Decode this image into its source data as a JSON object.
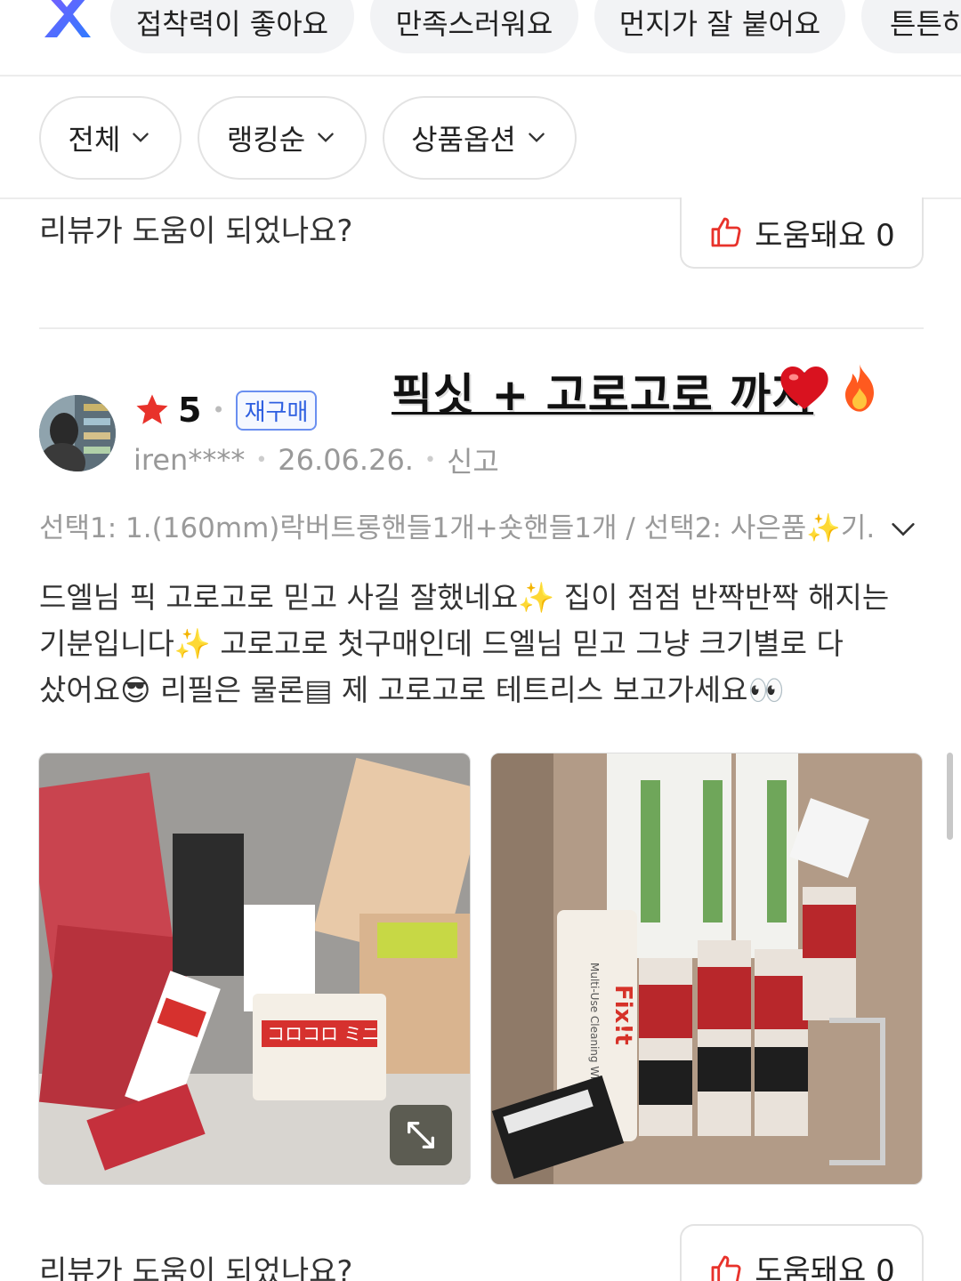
{
  "keyword_chips": [
    "접착력이 좋아요",
    "만족스러워요",
    "먼지가 잘 붙어요",
    "튼튼하"
  ],
  "filters": [
    "전체",
    "랭킹순",
    "상품옵션"
  ],
  "help_prompt": "리뷰가 도움이 되었나요?",
  "helpful_label": "도움돼요 0",
  "review": {
    "rating": "5",
    "rebuy_badge": "재구매",
    "user": "iren****",
    "date": "26.06.26.",
    "report": "신고",
    "title_text": "픽싯 + 고로고로 까지",
    "option": "선택1: 1.(160mm)락버트롱핸들1개+숏핸들1개 / 선택2: 사은품✨기...",
    "body_lines": [
      "드엘님 픽 고로고로 믿고 사길 잘했네요✨ 집이 점점 반짝반짝 해지는",
      "기분입니다✨ 고로고로 첫구매인데 드엘님 믿고 그냥 크기별로 다",
      "샀어요😎 리필은 물론▤ 제 고로고로 테트리스 보고가세요👀"
    ],
    "photo_texts": {
      "left_label": "コロコロ ミニ",
      "right_label": "Fix!t",
      "right_sub": "Multi-Use Cleaning Wipes"
    }
  },
  "colors": {
    "accent_blue": "#2e5fe0",
    "star_red": "#e8322b",
    "thumb_red": "#e8322b",
    "border": "#e3e3e3"
  },
  "icons": [
    "app-logo-icon",
    "chevron-down-icon",
    "thumb-up-icon",
    "star-icon",
    "expand-icon",
    "heart-emoji-icon",
    "fire-emoji-icon"
  ]
}
